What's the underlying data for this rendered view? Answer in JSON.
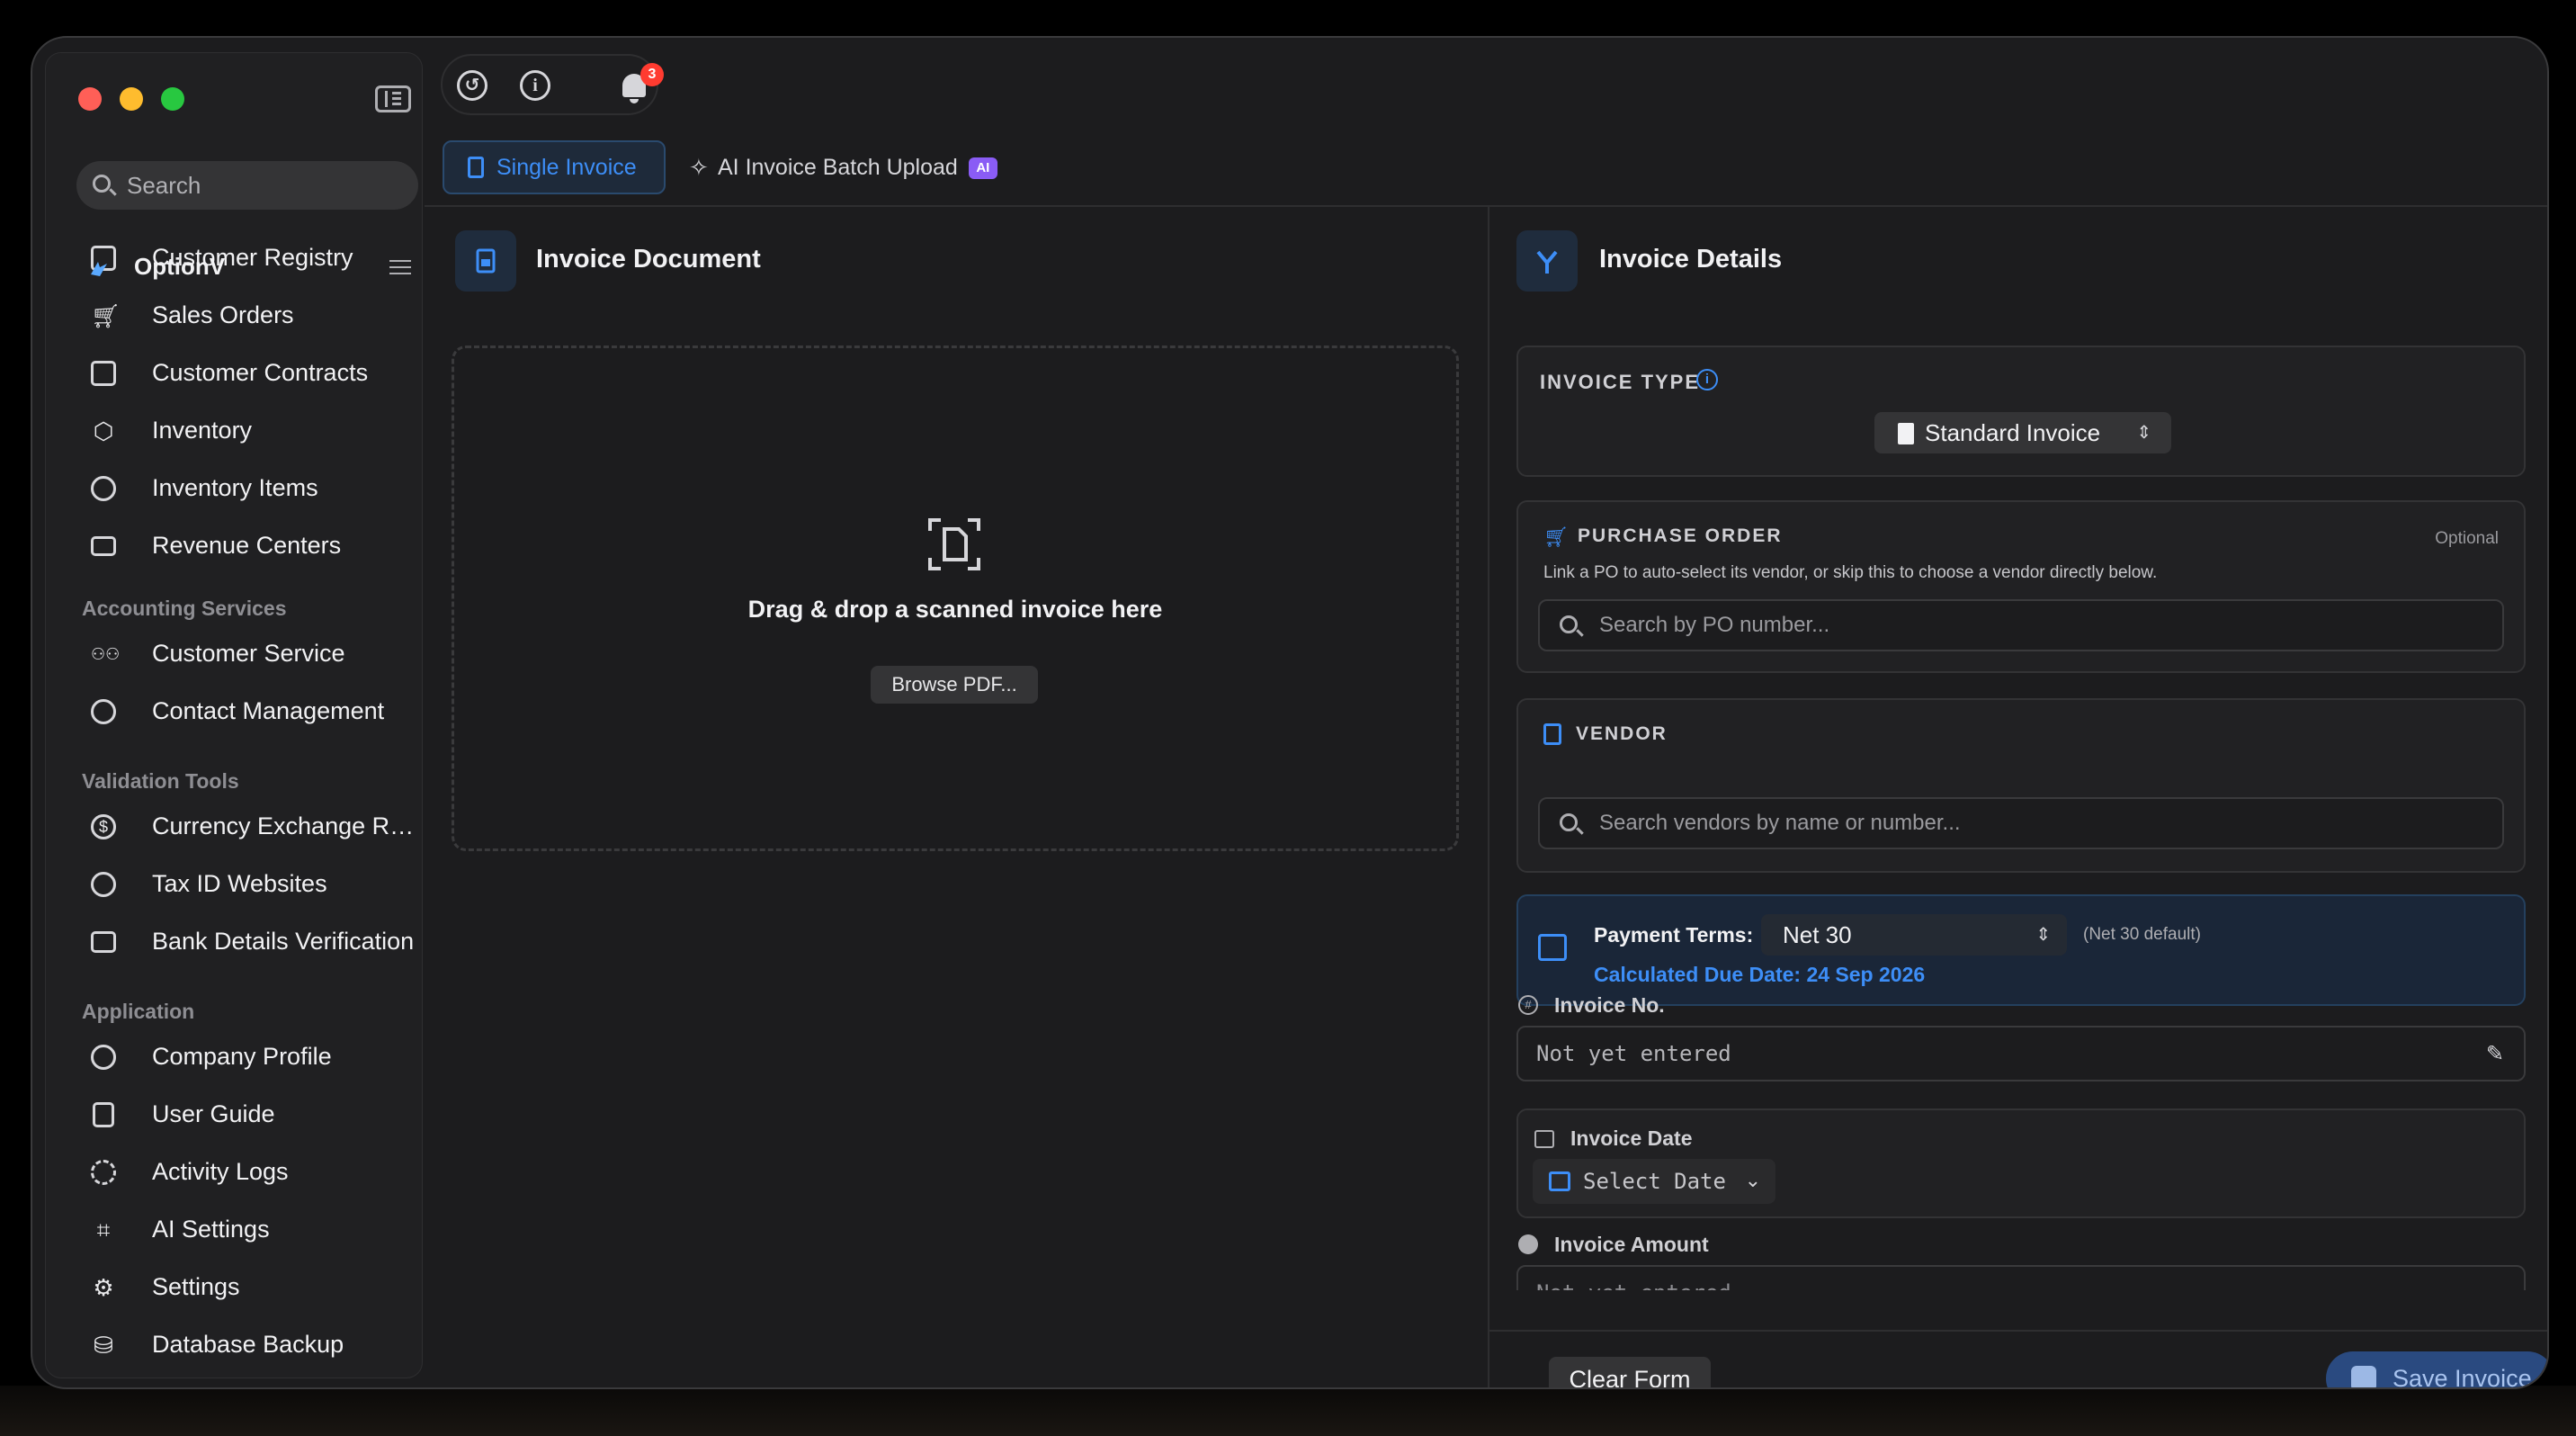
{
  "sidebar": {
    "search_placeholder": "Search",
    "brand": "OptionV",
    "items_top": [
      {
        "label": "Customer Registry"
      },
      {
        "label": "Sales Orders"
      },
      {
        "label": "Customer Contracts"
      },
      {
        "label": "Inventory"
      },
      {
        "label": "Inventory Items"
      },
      {
        "label": "Revenue Centers"
      }
    ],
    "section_accounting": "Accounting Services",
    "items_accounting": [
      {
        "label": "Customer Service"
      },
      {
        "label": "Contact Management"
      }
    ],
    "section_validation": "Validation Tools",
    "items_validation": [
      {
        "label": "Currency Exchange Ra..."
      },
      {
        "label": "Tax ID Websites"
      },
      {
        "label": "Bank Details Verification"
      }
    ],
    "section_application": "Application",
    "items_application": [
      {
        "label": "Company Profile"
      },
      {
        "label": "User Guide"
      },
      {
        "label": "Activity Logs"
      },
      {
        "label": "AI Settings"
      },
      {
        "label": "Settings"
      },
      {
        "label": "Database Backup"
      }
    ]
  },
  "toolbar": {
    "notification_count": "3"
  },
  "tabs": {
    "single": "Single Invoice",
    "batch": "AI Invoice Batch Upload",
    "batch_badge": "AI"
  },
  "document_panel": {
    "title": "Invoice Document",
    "drop_text": "Drag & drop a scanned invoice here",
    "browse_label": "Browse PDF..."
  },
  "details_panel": {
    "title": "Invoice Details",
    "invoice_type_label": "INVOICE TYPE",
    "invoice_type_value": "Standard Invoice",
    "purchase_order_label": "PURCHASE ORDER",
    "purchase_order_optional": "Optional",
    "purchase_order_hint": "Link a PO to auto-select its vendor, or skip this to choose a vendor directly below.",
    "purchase_order_placeholder": "Search by PO number...",
    "vendor_label": "VENDOR",
    "vendor_placeholder": "Search vendors by name or number...",
    "payment_terms_label": "Payment Terms:",
    "payment_terms_value": "Net 30",
    "payment_terms_default": "(Net 30 default)",
    "due_date": "Calculated Due Date: 24 Sep 2026",
    "invoice_no_label": "Invoice No.",
    "invoice_no_value": "Not yet entered",
    "invoice_date_label": "Invoice Date",
    "invoice_date_value": "Select Date",
    "invoice_amount_label": "Invoice Amount",
    "invoice_amount_value": "Not yet entered"
  },
  "actions": {
    "clear": "Clear Form",
    "save": "Save Invoice"
  },
  "colors": {
    "accent": "#3d8ef7",
    "badge": "#ff3b30",
    "ai_pill": "#8a5cf5"
  }
}
